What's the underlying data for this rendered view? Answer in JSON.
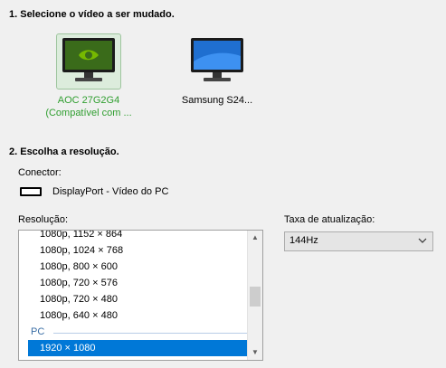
{
  "section1": {
    "title": "1. Selecione o vídeo a ser mudado."
  },
  "monitors": [
    {
      "line1": "AOC 27G2G4",
      "line2": "(Compatível com ...",
      "selected": true,
      "icon": "nvidia-monitor-icon"
    },
    {
      "line1": "Samsung S24...",
      "line2": "",
      "selected": false,
      "icon": "windows-monitor-icon"
    }
  ],
  "section2": {
    "title": "2. Escolha a resolução."
  },
  "connector": {
    "label": "Conector:",
    "value": "DisplayPort - Vídeo do PC",
    "icon": "displayport-icon"
  },
  "resolution": {
    "label": "Resolução:",
    "items": [
      "1080p, 1152 × 864",
      "1080p, 1024 × 768",
      "1080p, 800 × 600",
      "1080p, 720 × 576",
      "1080p, 720 × 480",
      "1080p, 640 × 480"
    ],
    "group": "PC",
    "selected": "1920 × 1080"
  },
  "refresh": {
    "label": "Taxa de atualização:",
    "value": "144Hz"
  },
  "colors": {
    "selected_monitor_text": "#2f9e2f",
    "selection": "#0078d7",
    "group_text": "#3a6ea5"
  }
}
